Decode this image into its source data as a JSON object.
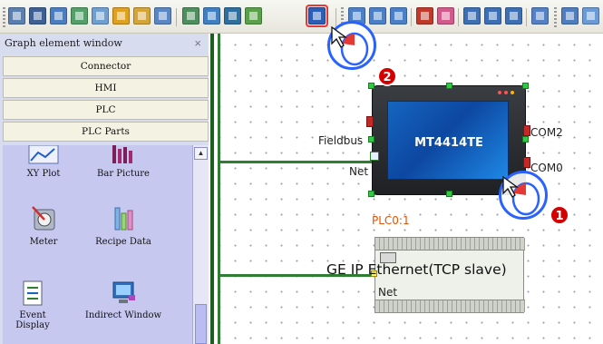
{
  "left_panel": {
    "title": "Graph element window",
    "close_glyph": "×",
    "categories": [
      "Connector",
      "HMI",
      "PLC",
      "PLC Parts"
    ],
    "parts": [
      {
        "label": "XY Plot",
        "icon": "xy-plot-icon"
      },
      {
        "label": "Bar Picture",
        "icon": "bar-picture-icon"
      },
      {
        "label": "Meter",
        "icon": "meter-icon"
      },
      {
        "label": "Recipe Data",
        "icon": "recipe-data-icon"
      },
      {
        "label": "Event Display",
        "icon": "event-display-icon"
      },
      {
        "label": "Indirect Window",
        "icon": "indirect-window-icon"
      }
    ],
    "scroll_up_glyph": "▲"
  },
  "canvas": {
    "hmi": {
      "model": "MT4414TE",
      "label_fieldbus": "Fieldbus",
      "label_net": "Net",
      "label_com2": "COM2",
      "label_com0": "COM0"
    },
    "plc": {
      "id": "PLC0:1",
      "name": "GE IP Ethernet(TCP slave)",
      "label_net": "Net"
    }
  },
  "callouts": {
    "step1": "1",
    "step2": "2"
  },
  "colors": {
    "highlight": "#e53935",
    "callout_border": "#2962ff",
    "badge": "#d50000",
    "link_green": "#2e7d32"
  }
}
